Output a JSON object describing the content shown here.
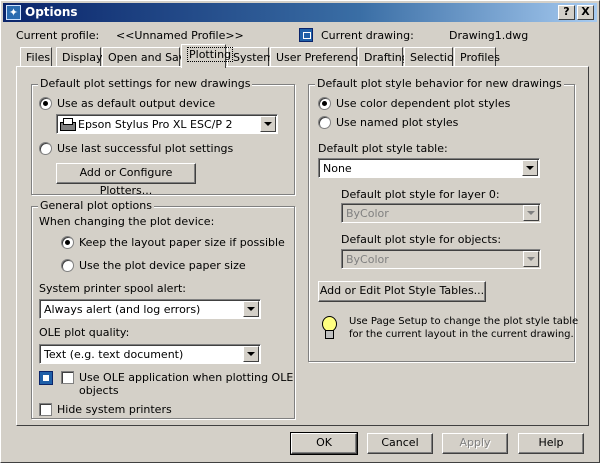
{
  "window": {
    "title": "Options"
  },
  "titlebar_buttons": {
    "help": "?",
    "close": "X"
  },
  "header": {
    "profile_label": "Current profile:",
    "profile_value": "<<Unnamed Profile>>",
    "drawing_label": "Current drawing:",
    "drawing_value": "Drawing1.dwg"
  },
  "tabs": [
    {
      "label": "Files"
    },
    {
      "label": "Display"
    },
    {
      "label": "Open and Save"
    },
    {
      "label": "Plotting",
      "active": true
    },
    {
      "label": "System"
    },
    {
      "label": "User Preferences"
    },
    {
      "label": "Drafting"
    },
    {
      "label": "Selection"
    },
    {
      "label": "Profiles"
    }
  ],
  "default_plot": {
    "legend": "Default plot settings for new drawings",
    "use_default_device": "Use as default output device",
    "device_value": "Epson Stylus Pro XL ESC/P 2",
    "use_last_successful": "Use last successful plot settings",
    "add_plotters_button": "Add or Configure Plotters..."
  },
  "general_options": {
    "legend": "General plot options",
    "when_changing": "When changing the plot device:",
    "keep_layout": "Keep the layout paper size if possible",
    "use_device_paper": "Use the plot device paper size",
    "spool_alert_label": "System printer spool alert:",
    "spool_alert_value": "Always alert (and log errors)",
    "ole_quality_label": "OLE plot quality:",
    "ole_quality_value": "Text (e.g. text document)",
    "use_ole_app_line1": "Use OLE application when plotting OLE",
    "use_ole_app_line2": "objects",
    "hide_printers": "Hide system printers"
  },
  "plot_style": {
    "legend": "Default plot style behavior for new drawings",
    "color_dependent": "Use color dependent plot styles",
    "named": "Use named plot styles",
    "table_label": "Default plot style table:",
    "table_value": "None",
    "layer0_label": "Default plot style for layer 0:",
    "layer0_value": "ByColor",
    "objects_label": "Default plot style for objects:",
    "objects_value": "ByColor",
    "add_edit_button": "Add or Edit Plot Style Tables...",
    "tip_line1": "Use Page Setup to change the plot style table",
    "tip_line2": "for the current layout in the current drawing."
  },
  "footer": {
    "ok": "OK",
    "cancel": "Cancel",
    "apply": "Apply",
    "help": "Help"
  },
  "icons": {
    "app": "options-icon",
    "drawing": "drawing-icon",
    "printer": "printer-icon",
    "tip": "lightbulb-icon",
    "ole": "ole-icon"
  },
  "colors": {
    "title_start": "#0a246a",
    "title_end": "#a6caf0",
    "face": "#d4d0c8"
  }
}
